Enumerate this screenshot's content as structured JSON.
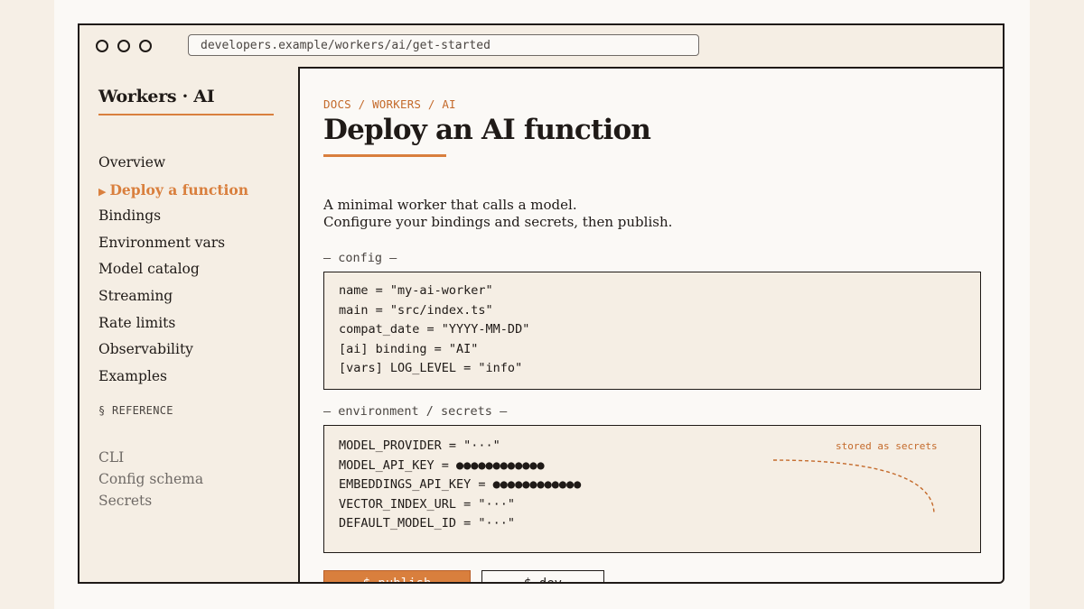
{
  "browser": {
    "url": "developers.example/workers/ai/get-started"
  },
  "sidebar": {
    "brand": "Workers · AI",
    "items": [
      {
        "label": "Overview",
        "active": false
      },
      {
        "label": "Deploy a function",
        "active": true
      },
      {
        "label": "Bindings",
        "active": false
      },
      {
        "label": "Environment vars",
        "active": false
      },
      {
        "label": "Model catalog",
        "active": false
      },
      {
        "label": "Streaming",
        "active": false
      },
      {
        "label": "Rate limits",
        "active": false
      },
      {
        "label": "Observability",
        "active": false
      },
      {
        "label": "Examples",
        "active": false
      }
    ],
    "active_marker": "▶",
    "reference_heading": "§ REFERENCE",
    "reference_items": [
      "CLI",
      "Config schema",
      "Secrets"
    ]
  },
  "main": {
    "breadcrumb": "DOCS / WORKERS / AI",
    "title": "Deploy an AI function",
    "description": [
      "A minimal worker that calls a model.",
      "Configure your bindings and secrets, then publish."
    ],
    "config": {
      "label": "— config —",
      "lines": [
        "name = \"my-ai-worker\"",
        "main = \"src/index.ts\"",
        "compat_date = \"YYYY-MM-DD\"",
        "[ai] binding = \"AI\"",
        "[vars] LOG_LEVEL = \"info\""
      ]
    },
    "env": {
      "label": "— environment / secrets —",
      "lines": [
        "MODEL_PROVIDER = \"···\"",
        "MODEL_API_KEY = ●●●●●●●●●●●●",
        "EMBEDDINGS_API_KEY = ●●●●●●●●●●●●",
        "VECTOR_INDEX_URL = \"···\"",
        "DEFAULT_MODEL_ID = \"···\""
      ],
      "annotation": "stored as secrets"
    },
    "actions": {
      "publish_label": "$ publish",
      "dev_label": "$ dev"
    }
  },
  "colors": {
    "accent": "#d97f3d",
    "ink": "#1f1a17",
    "panel": "#f5eee4",
    "background": "#fbf9f6"
  }
}
